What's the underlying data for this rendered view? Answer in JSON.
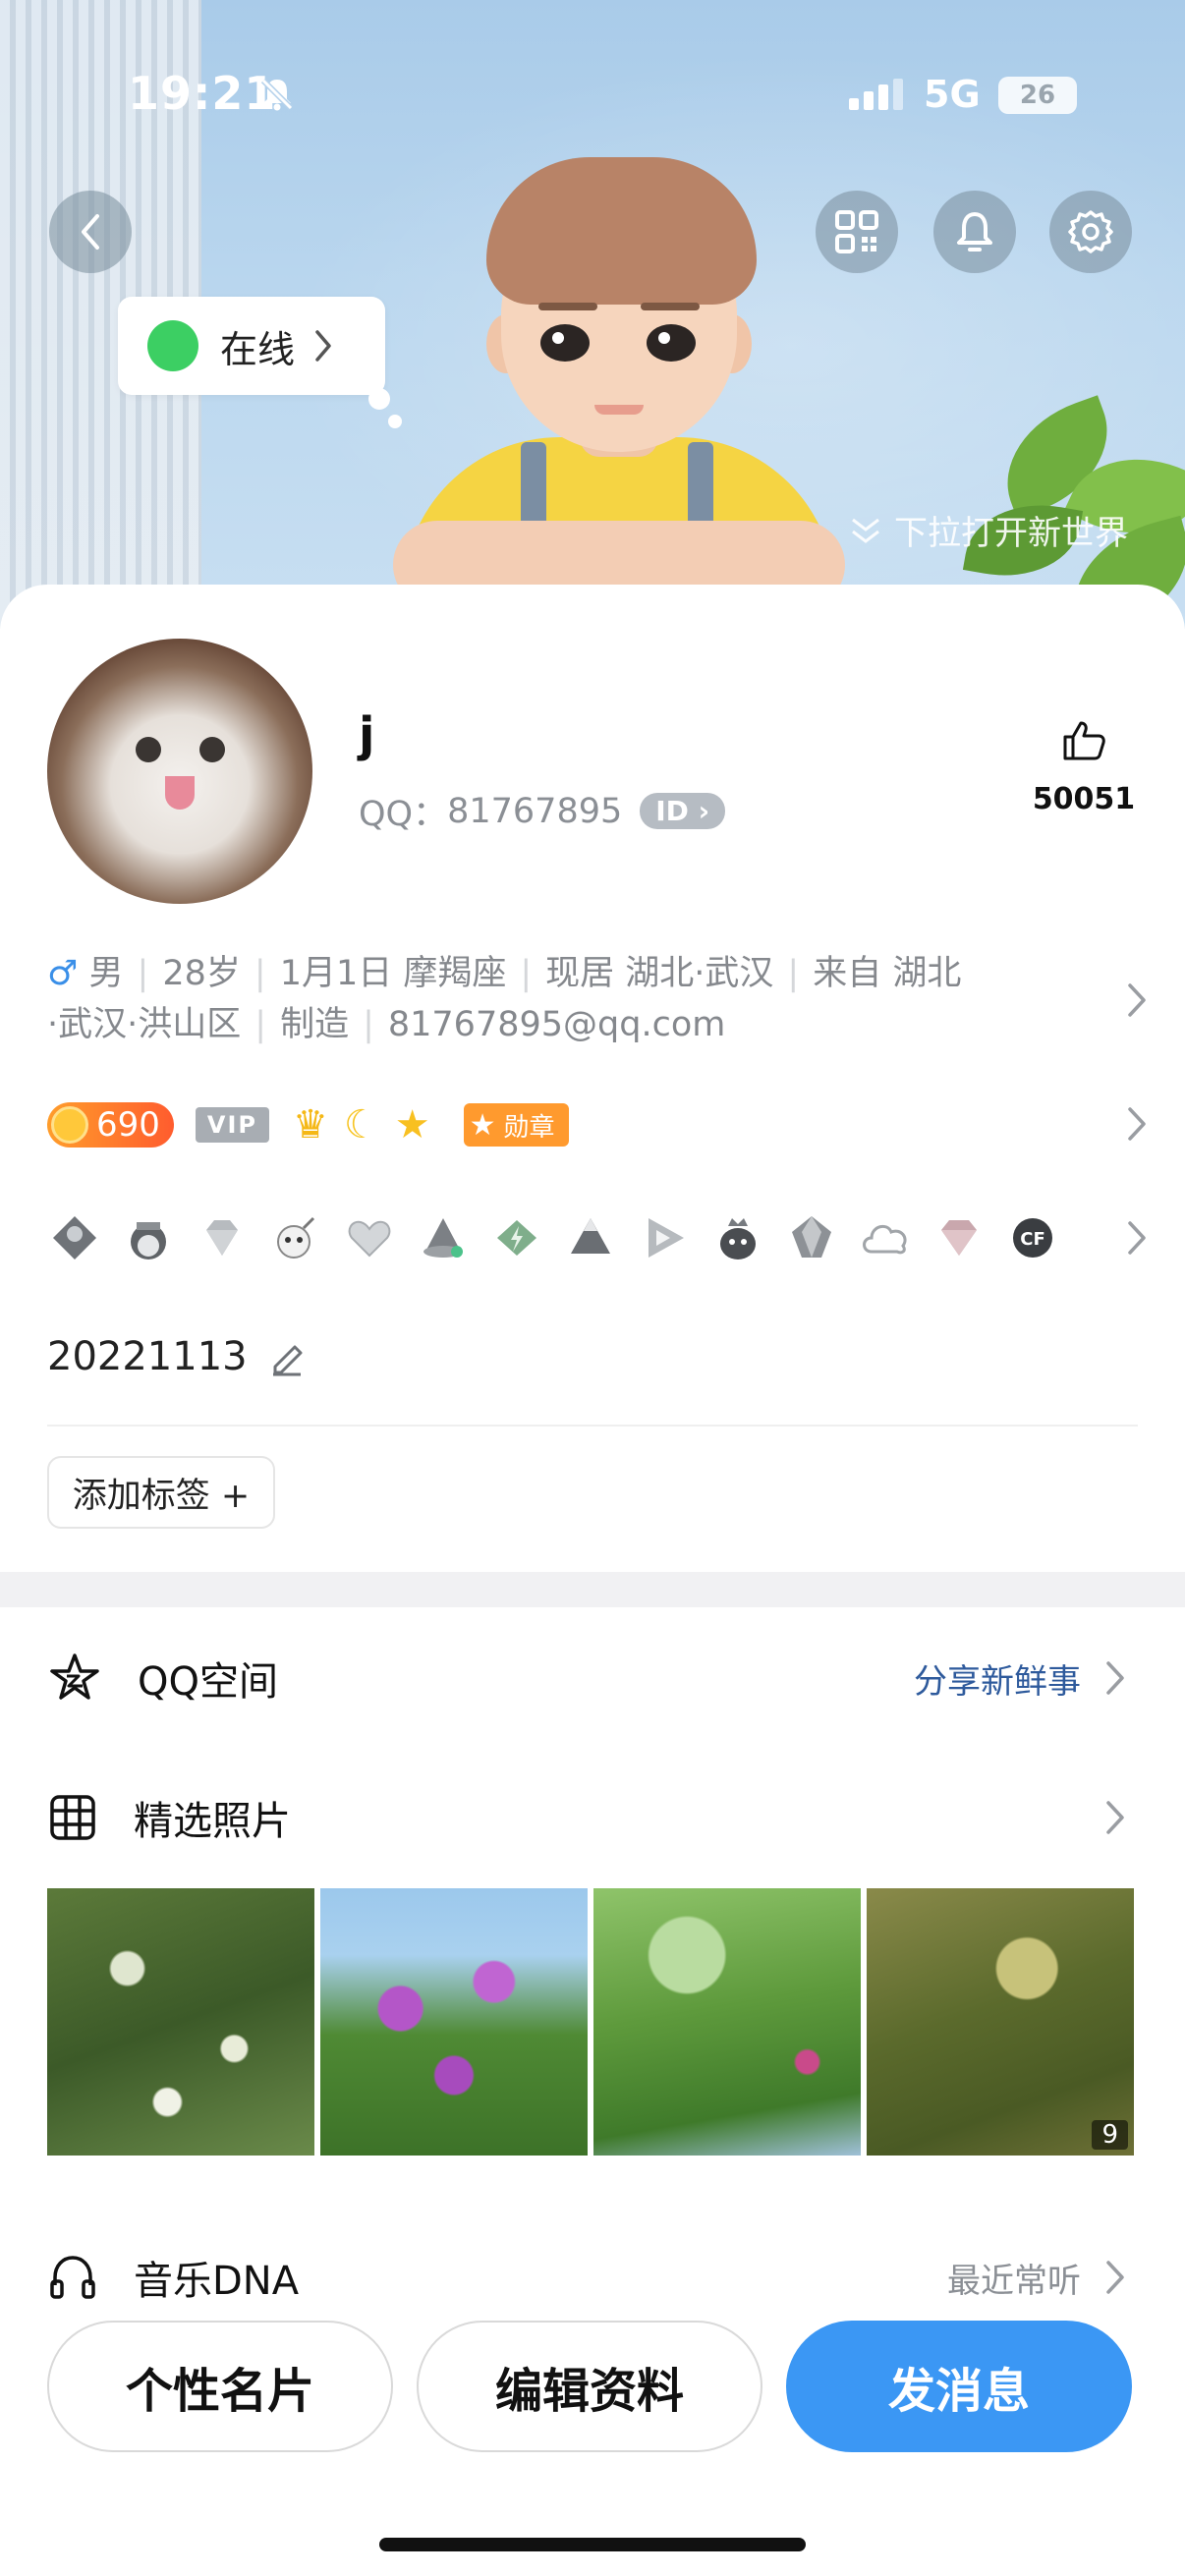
{
  "status_bar": {
    "time": "19:21",
    "network": "5G",
    "battery": "26"
  },
  "header": {
    "online_label": "在线",
    "pull_hint": "下拉打开新世界"
  },
  "profile": {
    "nickname": "j",
    "qq_label": "QQ：",
    "qq_number": "81767895",
    "id_badge": "ID",
    "likes": "50051"
  },
  "info": {
    "gender": "男",
    "age": "28岁",
    "birthday": "1月1日 摩羯座",
    "location": "现居 湖北·武汉",
    "hometown_a": "来自 湖北",
    "hometown_b": "·武汉·洪山区",
    "job": "制造",
    "email": "81767895@qq.com"
  },
  "badges": {
    "gold_level": "690",
    "vip": "VIP",
    "medal": "勋章"
  },
  "signature": "20221113",
  "add_tag": "添加标签 +",
  "sections": {
    "qzone_label": "QQ空间",
    "qzone_action": "分享新鲜事",
    "photos_label": "精选照片",
    "photo_count": "9",
    "music_label": "音乐DNA",
    "music_action": "最近常听"
  },
  "buttons": {
    "card": "个性名片",
    "edit": "编辑资料",
    "message": "发消息"
  },
  "colors": {
    "accent": "#3b97f4",
    "online": "#3ccf63",
    "link": "#2e5a9c"
  }
}
